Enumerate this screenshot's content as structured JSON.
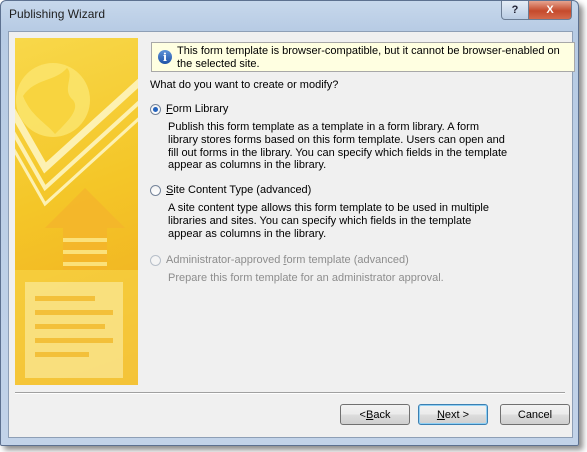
{
  "window": {
    "title": "Publishing Wizard",
    "help_glyph": "?",
    "close_glyph": "X"
  },
  "info": {
    "icon": "info-icon",
    "text": "This form template is browser-compatible, but it cannot be browser-enabled on the selected site."
  },
  "question": "What do you want to create or modify?",
  "options": [
    {
      "label_prefix": "",
      "label_key": "F",
      "label_rest": "orm Library",
      "selected": true,
      "enabled": true,
      "description": "Publish this form template as a template in a form library. A form library stores forms based on this form template. Users can open and fill out forms in the library. You can specify which fields in the template appear as columns in the library."
    },
    {
      "label_prefix": "",
      "label_key": "S",
      "label_rest": "ite Content Type (advanced)",
      "selected": false,
      "enabled": true,
      "description": "A site content type allows this form template to be used in multiple libraries and sites. You can specify which fields in the template appear as columns in the library."
    },
    {
      "label_prefix": "Administrator-approved ",
      "label_key": "f",
      "label_rest": "orm template (advanced)",
      "selected": false,
      "enabled": false,
      "description": "Prepare this form template for an administrator approval."
    }
  ],
  "buttons": {
    "back": {
      "prefix": "< ",
      "key": "B",
      "rest": "ack"
    },
    "next": {
      "prefix": "",
      "key": "N",
      "rest": "ext >"
    },
    "cancel": "Cancel"
  },
  "colors": {
    "banner_yellow": "#f4c628",
    "banner_orange": "#f0a81e",
    "info_bg": "#ffffe1",
    "accent_blue": "#2463be"
  }
}
